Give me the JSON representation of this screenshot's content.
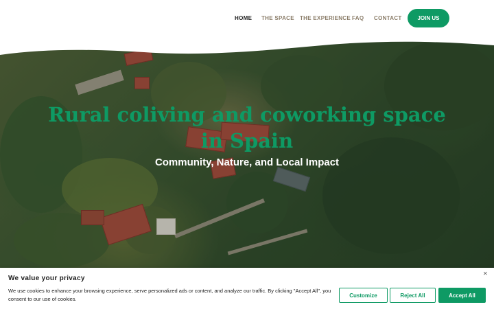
{
  "colors": {
    "accent": "#0e9a64",
    "nav_text": "#8a7c68",
    "nav_active": "#222222",
    "hero_title": "#0e9a64",
    "banner_text": "#212121"
  },
  "nav": {
    "items": [
      {
        "label": "HOME",
        "active": true
      },
      {
        "label": "THE SPACE",
        "active": false
      },
      {
        "label": "THE EXPERIENCE",
        "active": false
      },
      {
        "label": "FAQ",
        "active": false
      },
      {
        "label": "CONTACT",
        "active": false
      }
    ],
    "cta_label": "JOIN US"
  },
  "hero": {
    "title": "Rural coliving and coworking space in Spain",
    "subtitle": "Community, Nature, and Local Impact"
  },
  "cookie_banner": {
    "title": "We value your privacy",
    "text": "We use cookies to enhance your browsing experience, serve personalized ads or content, and analyze our traffic. By clicking \"Accept All\", you consent to our use of cookies.",
    "close_icon": "close-icon",
    "customize_label": "Customize",
    "reject_label": "Reject All",
    "accept_label": "Accept All"
  }
}
